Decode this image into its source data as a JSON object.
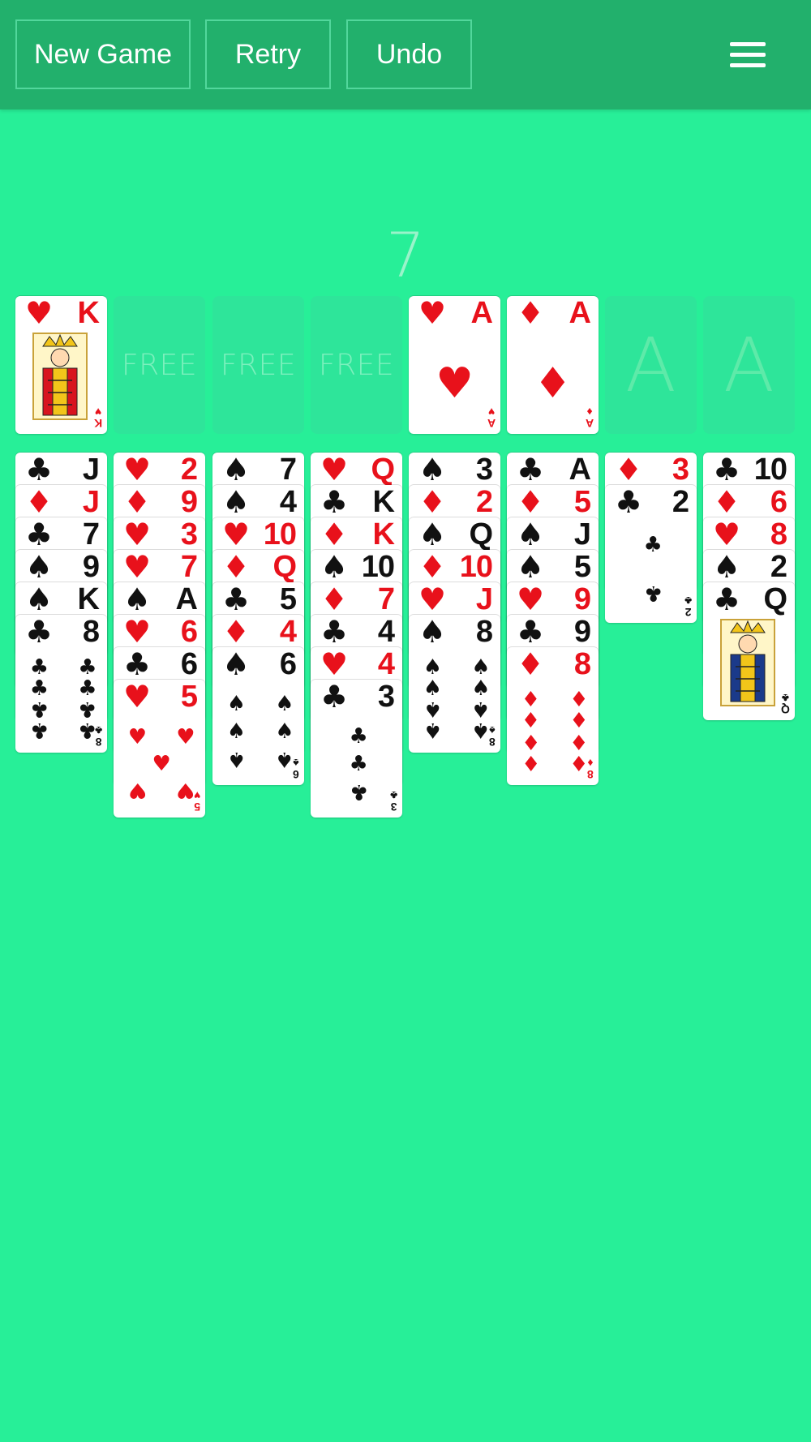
{
  "toolbar": {
    "new_game_label": "New Game",
    "retry_label": "Retry",
    "undo_label": "Undo",
    "menu_icon": "hamburger-menu-icon"
  },
  "counter": "7",
  "free_cells": [
    {
      "card": {
        "rank": "K",
        "suit": "hearts"
      }
    },
    {
      "label": "FREE"
    },
    {
      "label": "FREE"
    },
    {
      "label": "FREE"
    }
  ],
  "foundations": [
    {
      "card": {
        "rank": "A",
        "suit": "hearts"
      }
    },
    {
      "card": {
        "rank": "A",
        "suit": "diamonds"
      }
    },
    {
      "label": "A"
    },
    {
      "label": "A"
    }
  ],
  "tableau": [
    [
      {
        "rank": "J",
        "suit": "clubs"
      },
      {
        "rank": "J",
        "suit": "diamonds"
      },
      {
        "rank": "7",
        "suit": "clubs"
      },
      {
        "rank": "9",
        "suit": "spades"
      },
      {
        "rank": "K",
        "suit": "spades"
      },
      {
        "rank": "8",
        "suit": "clubs"
      }
    ],
    [
      {
        "rank": "2",
        "suit": "hearts"
      },
      {
        "rank": "9",
        "suit": "diamonds"
      },
      {
        "rank": "3",
        "suit": "hearts"
      },
      {
        "rank": "7",
        "suit": "hearts"
      },
      {
        "rank": "A",
        "suit": "spades"
      },
      {
        "rank": "6",
        "suit": "hearts"
      },
      {
        "rank": "6",
        "suit": "clubs"
      },
      {
        "rank": "5",
        "suit": "hearts"
      }
    ],
    [
      {
        "rank": "7",
        "suit": "spades"
      },
      {
        "rank": "4",
        "suit": "spades"
      },
      {
        "rank": "10",
        "suit": "hearts"
      },
      {
        "rank": "Q",
        "suit": "diamonds"
      },
      {
        "rank": "5",
        "suit": "clubs"
      },
      {
        "rank": "4",
        "suit": "diamonds"
      },
      {
        "rank": "6",
        "suit": "spades"
      }
    ],
    [
      {
        "rank": "Q",
        "suit": "hearts"
      },
      {
        "rank": "K",
        "suit": "clubs"
      },
      {
        "rank": "K",
        "suit": "diamonds"
      },
      {
        "rank": "10",
        "suit": "spades"
      },
      {
        "rank": "7",
        "suit": "diamonds"
      },
      {
        "rank": "4",
        "suit": "clubs"
      },
      {
        "rank": "4",
        "suit": "hearts"
      },
      {
        "rank": "3",
        "suit": "clubs"
      }
    ],
    [
      {
        "rank": "3",
        "suit": "spades"
      },
      {
        "rank": "2",
        "suit": "diamonds"
      },
      {
        "rank": "Q",
        "suit": "spades"
      },
      {
        "rank": "10",
        "suit": "diamonds"
      },
      {
        "rank": "J",
        "suit": "hearts"
      },
      {
        "rank": "8",
        "suit": "spades"
      }
    ],
    [
      {
        "rank": "A",
        "suit": "clubs"
      },
      {
        "rank": "5",
        "suit": "diamonds"
      },
      {
        "rank": "J",
        "suit": "spades"
      },
      {
        "rank": "5",
        "suit": "spades"
      },
      {
        "rank": "9",
        "suit": "hearts"
      },
      {
        "rank": "9",
        "suit": "clubs"
      },
      {
        "rank": "8",
        "suit": "diamonds"
      }
    ],
    [
      {
        "rank": "3",
        "suit": "diamonds"
      },
      {
        "rank": "2",
        "suit": "clubs"
      }
    ],
    [
      {
        "rank": "10",
        "suit": "clubs"
      },
      {
        "rank": "6",
        "suit": "diamonds"
      },
      {
        "rank": "8",
        "suit": "hearts"
      },
      {
        "rank": "2",
        "suit": "spades"
      },
      {
        "rank": "Q",
        "suit": "clubs"
      }
    ]
  ],
  "colors": {
    "felt": "#27ef98",
    "toolbar": "#22b06c",
    "red_suit": "#e8111b",
    "black_suit": "#111111"
  }
}
